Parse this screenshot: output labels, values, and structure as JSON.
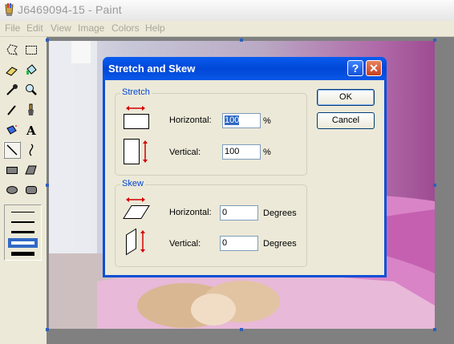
{
  "window": {
    "title": "J6469094-15 - Paint"
  },
  "menu": [
    "File",
    "Edit",
    "View",
    "Image",
    "Colors",
    "Help"
  ],
  "tools": [
    {
      "name": "free-form-select-icon"
    },
    {
      "name": "rect-select-icon"
    },
    {
      "name": "eraser-icon"
    },
    {
      "name": "fill-icon"
    },
    {
      "name": "pick-color-icon"
    },
    {
      "name": "magnifier-icon"
    },
    {
      "name": "pencil-icon"
    },
    {
      "name": "brush-icon"
    },
    {
      "name": "airbrush-icon"
    },
    {
      "name": "text-icon"
    },
    {
      "name": "line-icon",
      "selected": true
    },
    {
      "name": "curve-icon"
    },
    {
      "name": "rectangle-icon"
    },
    {
      "name": "polygon-icon"
    },
    {
      "name": "ellipse-icon"
    },
    {
      "name": "rounded-rect-icon"
    }
  ],
  "line_widths_selected_index": 3,
  "dialog": {
    "title": "Stretch and Skew",
    "help_button": "?",
    "close_button": "✕",
    "stretch": {
      "label": "Stretch",
      "horizontal_label": "Horizontal:",
      "horizontal_value": "100",
      "horizontal_unit": "%",
      "vertical_label": "Vertical:",
      "vertical_value": "100",
      "vertical_unit": "%"
    },
    "skew": {
      "label": "Skew",
      "horizontal_label": "Horizontal:",
      "horizontal_value": "0",
      "horizontal_unit": "Degrees",
      "vertical_label": "Vertical:",
      "vertical_value": "0",
      "vertical_unit": "Degrees"
    },
    "ok_label": "OK",
    "cancel_label": "Cancel"
  },
  "colors": {
    "title_blue": "#0a4fd6",
    "group_label": "#0046d5",
    "selection": "#316ac5",
    "arrow_red": "#d40000"
  }
}
